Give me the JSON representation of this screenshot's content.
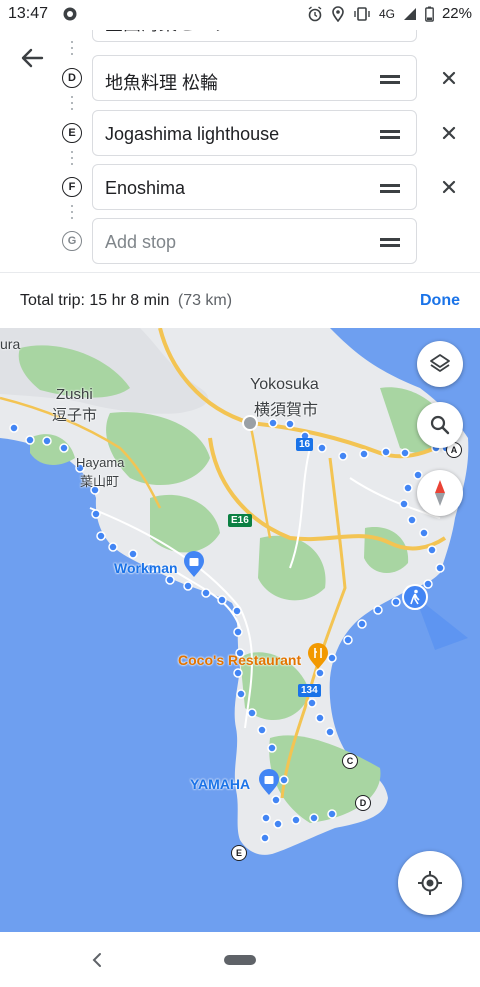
{
  "status_bar": {
    "time": "13:47",
    "network": "4G",
    "battery": "22%"
  },
  "stops": [
    {
      "letter": "C",
      "value": "金田海業センター",
      "has_remove": true
    },
    {
      "letter": "D",
      "value": "地魚料理 松輪",
      "has_remove": true
    },
    {
      "letter": "E",
      "value": "Jogashima lighthouse",
      "has_remove": true
    },
    {
      "letter": "F",
      "value": "Enoshima",
      "has_remove": true
    },
    {
      "letter": "G",
      "value": "",
      "placeholder": "Add stop",
      "has_remove": false
    }
  ],
  "trip": {
    "label": "Total trip: 15 hr 8 min",
    "distance": "(73 km)",
    "done_label": "Done"
  },
  "map": {
    "place_labels": {
      "yokosuka_en": "Yokosuka",
      "yokosuka_ja": "横須賀市",
      "zushi_en": "Zushi",
      "zushi_ja": "逗子市",
      "hayama_en": "Hayama",
      "hayama_ja": "葉山町",
      "kamakura_partial": "ura"
    },
    "pois": {
      "workman": "Workman",
      "cocos": "Coco's Restaurant",
      "yamaha": "YAMAHA"
    },
    "route_signs": {
      "r16": "16",
      "e16": "E16",
      "r134": "134"
    },
    "waypoint_markers": {
      "a": "A",
      "c": "C",
      "d": "D",
      "e": "E"
    },
    "colors": {
      "water": "#6e9ff0",
      "land": "#e8eaed",
      "park": "#a8d5a2",
      "route_dot": "#4285f4",
      "highway": "#f3c453"
    }
  }
}
